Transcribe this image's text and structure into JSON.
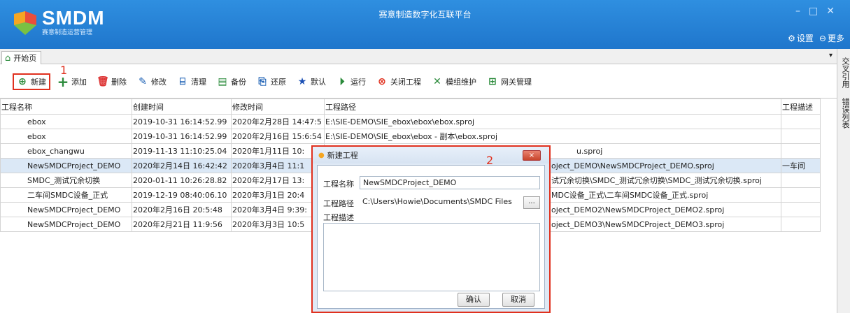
{
  "app": {
    "logo_text": "SMDM",
    "logo_sub": "赛意制造运营管理",
    "title": "赛意制造数字化互联平台",
    "settings_label": "设置",
    "more_label": "更多"
  },
  "tabs": {
    "start_label": "开始页"
  },
  "toolbar": {
    "new": "新建",
    "add": "添加",
    "delete": "删除",
    "edit": "修改",
    "clean": "清理",
    "backup": "备份",
    "restore": "还原",
    "default": "默认",
    "run": "运行",
    "close_project": "关闭工程",
    "module_maint": "模组维护",
    "gateway": "网关管理"
  },
  "markers": {
    "one": "1",
    "two": "2"
  },
  "grid": {
    "columns": [
      "工程名称",
      "创建时间",
      "修改时间",
      "工程路径",
      "工程描述"
    ],
    "rows": [
      [
        "ebox",
        "2019-10-31 16:14:52.99",
        "2020年2月28日 14:47:5",
        "E:\\SIE-DEMO\\SIE_ebox\\ebox\\ebox.sproj",
        ""
      ],
      [
        "ebox",
        "2019-10-31 16:14:52.99",
        "2020年2月16日 15:6:54",
        "E:\\SIE-DEMO\\SIE_ebox\\ebox - 副本\\ebox.sproj",
        ""
      ],
      [
        "ebox_changwu",
        "2019-11-13 11:10:25.04",
        "2020年1月11日 10:",
        "u.sproj",
        ""
      ],
      [
        "NewSMDCProject_DEMO",
        "2020年2月14日 16:42:42",
        "2020年3月4日 11:1",
        "oject_DEMO\\NewSMDCProject_DEMO.sproj",
        "一车间"
      ],
      [
        "SMDC_测试冗余切换",
        "2020-01-11 10:26:28.82",
        "2020年2月17日 13:",
        "试冗余切换\\SMDC_测试冗余切换\\SMDC_测试冗余切换.sproj",
        ""
      ],
      [
        "二车间SMDC设备_正式",
        "2019-12-19 08:40:06.10",
        "2020年3月1日 20:4",
        "MDC设备_正式\\二车间SMDC设备_正式.sproj",
        ""
      ],
      [
        "NewSMDCProject_DEMO",
        "2020年2月16日 20:5:48",
        "2020年3月4日 9:39:",
        "oject_DEMO2\\NewSMDCProject_DEMO2.sproj",
        ""
      ],
      [
        "NewSMDCProject_DEMO",
        "2020年2月21日 11:9:56",
        "2020年3月3日 10:5",
        "oject_DEMO3\\NewSMDCProject_DEMO3.sproj",
        ""
      ]
    ]
  },
  "side": {
    "label1": "交叉引用",
    "label2": "错误列表"
  },
  "dialog": {
    "title": "新建工程",
    "close": "×",
    "name_label": "工程名称",
    "name_value": "NewSMDCProject_DEMO",
    "path_label": "工程路径",
    "path_value": "C:\\Users\\Howie\\Documents\\SMDC Files",
    "browse": "...",
    "desc_label": "工程描述",
    "ok": "确认",
    "cancel": "取消"
  },
  "colors": {
    "titlebar": "#2f8fe0",
    "highlight": "#e0301e",
    "selected_row": "#dbe8f6"
  }
}
